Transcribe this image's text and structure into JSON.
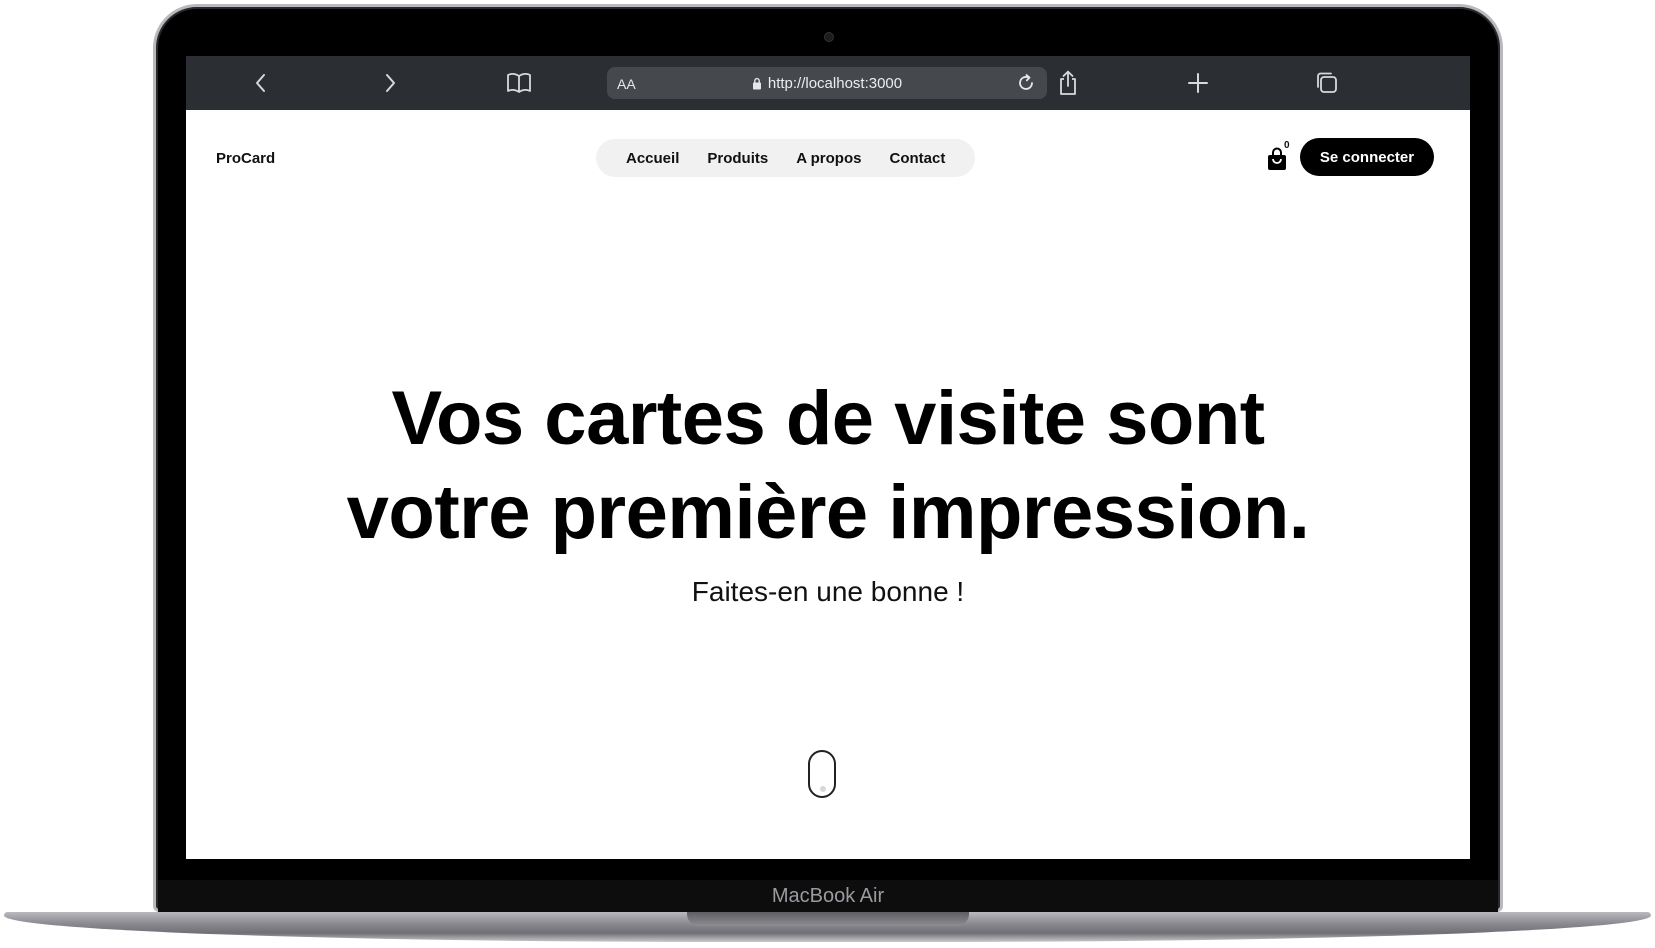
{
  "browser": {
    "back_icon": "chevron-left-icon",
    "forward_icon": "chevron-right-icon",
    "bookmarks_icon": "book-icon",
    "reader_label": "AA",
    "url": "http://localhost:3000",
    "lock_icon": "lock-icon",
    "reload_icon": "reload-icon",
    "share_icon": "share-icon",
    "new_tab_icon": "plus-icon",
    "tabs_icon": "tabs-icon"
  },
  "header": {
    "brand": "ProCard",
    "nav": [
      {
        "label": "Accueil"
      },
      {
        "label": "Produits"
      },
      {
        "label": "A propos"
      },
      {
        "label": "Contact"
      }
    ],
    "cart_count": "0",
    "login_label": "Se connecter"
  },
  "hero": {
    "line1": "Vos cartes de visite sont",
    "line2": "votre première impression.",
    "subtitle": "Faites-en une bonne !"
  },
  "device": {
    "label": "MacBook Air"
  },
  "colors": {
    "toolbar": "#2b2f33",
    "urlbar": "#45494e",
    "button": "#000000",
    "nav_pill": "#f1f1f1"
  }
}
